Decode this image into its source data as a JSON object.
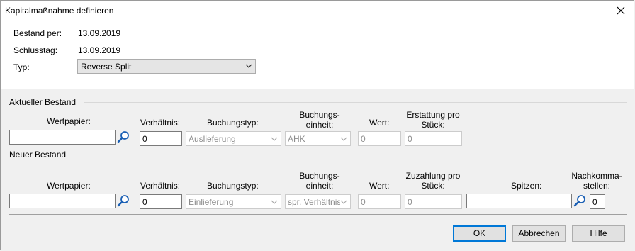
{
  "window": {
    "title": "Kapitalmaßnahme definieren"
  },
  "info": {
    "bestand_label": "Bestand per:",
    "bestand_value": "13.09.2019",
    "schlusstag_label": "Schlusstag:",
    "schlusstag_value": "13.09.2019",
    "typ_label": "Typ:",
    "typ_value": "Reverse Split"
  },
  "aktuell": {
    "section_label": "Aktueller Bestand",
    "wertpapier_label": "Wertpapier:",
    "wertpapier_value": "",
    "verhaeltnis_label": "Verhältnis:",
    "verhaeltnis_value": "0",
    "buchungstyp_label": "Buchungstyp:",
    "buchungstyp_value": "Auslieferung",
    "einheit_label_1": "Buchungs-",
    "einheit_label_2": "einheit:",
    "einheit_value": "AHK",
    "wert_label": "Wert:",
    "wert_value": "0",
    "erstattung_label_1": "Erstattung pro",
    "erstattung_label_2": "Stück:",
    "erstattung_value": "0"
  },
  "neu": {
    "section_label": "Neuer Bestand",
    "wertpapier_label": "Wertpapier:",
    "wertpapier_value": "",
    "verhaeltnis_label": "Verhältnis:",
    "verhaeltnis_value": "0",
    "buchungstyp_label": "Buchungstyp:",
    "buchungstyp_value": "Einlieferung",
    "einheit_label_1": "Buchungs-",
    "einheit_label_2": "einheit:",
    "einheit_value": "spr. Verhältnis",
    "wert_label": "Wert:",
    "wert_value": "0",
    "zuzahlung_label_1": "Zuzahlung pro",
    "zuzahlung_label_2": "Stück:",
    "zuzahlung_value": "0",
    "spitzen_label": "Spitzen:",
    "spitzen_value": "",
    "nachkomma_label_1": "Nachkomma-",
    "nachkomma_label_2": "stellen:",
    "nachkomma_value": "0"
  },
  "buttons": {
    "ok": "OK",
    "abbrechen": "Abbrechen",
    "hilfe": "Hilfe"
  }
}
